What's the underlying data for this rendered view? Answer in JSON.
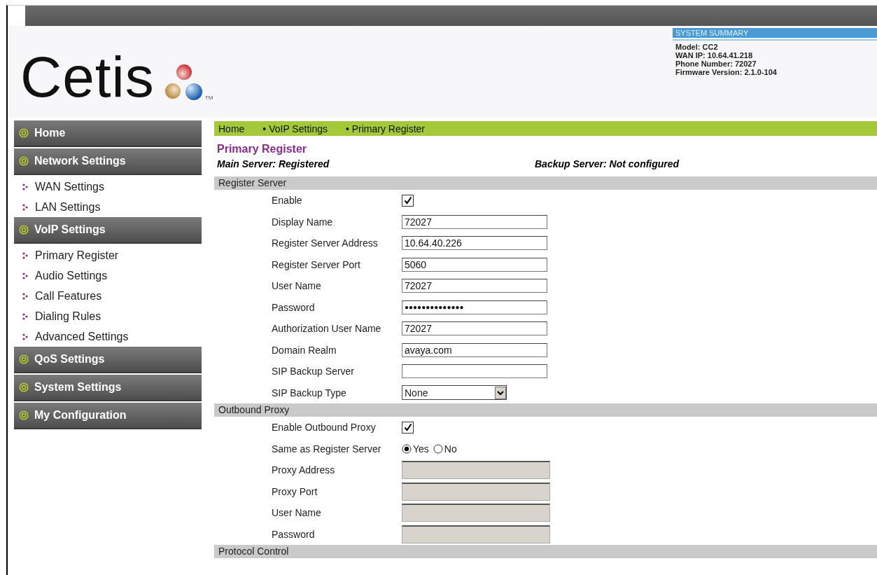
{
  "logo": {
    "wordmark": "Cetis",
    "trademark": "TM"
  },
  "system_summary": {
    "title": "SYSTEM SUMMARY",
    "lines": [
      "Model: CC2",
      "WAN IP: 10.64.41.218",
      "Phone Number: 72027",
      "Firmware Version: 2.1.0-104"
    ]
  },
  "sidebar": {
    "groups": [
      {
        "label": "Home"
      },
      {
        "label": "Network Settings",
        "children": [
          {
            "label": "WAN Settings"
          },
          {
            "label": "LAN Settings"
          }
        ]
      },
      {
        "label": "VoIP Settings",
        "children": [
          {
            "label": "Primary Register"
          },
          {
            "label": "Audio Settings"
          },
          {
            "label": "Call Features"
          },
          {
            "label": "Dialing Rules"
          },
          {
            "label": "Advanced Settings"
          }
        ]
      },
      {
        "label": "QoS Settings"
      },
      {
        "label": "System Settings"
      },
      {
        "label": "My Configuration"
      }
    ]
  },
  "breadcrumb": [
    "Home",
    "• VoIP Settings",
    "• Primary Register"
  ],
  "page_title": "Primary Register",
  "status": {
    "main": "Main Server: Registered",
    "backup": "Backup Server: Not configured"
  },
  "sections": [
    {
      "title": "Register Server",
      "rows": [
        {
          "kind": "checkbox",
          "label": "Enable",
          "checked": true
        },
        {
          "kind": "text",
          "label": "Display Name",
          "value": "72027",
          "disabled": false
        },
        {
          "kind": "text",
          "label": "Register Server Address",
          "value": "10.64.40.226",
          "disabled": false
        },
        {
          "kind": "text",
          "label": "Register Server Port",
          "value": "5060",
          "disabled": false
        },
        {
          "kind": "text",
          "label": "User Name",
          "value": "72027",
          "disabled": false
        },
        {
          "kind": "password",
          "label": "Password",
          "value": "●●●●●●●●●●●●●●",
          "disabled": false
        },
        {
          "kind": "text",
          "label": "Authorization User Name",
          "value": "72027",
          "disabled": false
        },
        {
          "kind": "text",
          "label": "Domain Realm",
          "value": "avaya.com",
          "disabled": false
        },
        {
          "kind": "text",
          "label": "SIP Backup Server",
          "disabled": false
        },
        {
          "kind": "select",
          "label": "SIP Backup Type",
          "value": "None"
        }
      ]
    },
    {
      "title": "Outbound Proxy",
      "rows": [
        {
          "kind": "checkbox",
          "label": "Enable Outbound Proxy",
          "checked": true
        },
        {
          "kind": "radio",
          "label": "Same as Register Server",
          "options": [
            {
              "label": "Yes",
              "selected": true
            },
            {
              "label": "No",
              "selected": false
            }
          ]
        },
        {
          "kind": "text",
          "label": "Proxy Address",
          "disabled": true
        },
        {
          "kind": "text",
          "label": "Proxy Port",
          "disabled": true
        },
        {
          "kind": "text",
          "label": "User Name",
          "disabled": true
        },
        {
          "kind": "text",
          "label": "Password",
          "disabled": true
        }
      ]
    },
    {
      "title": "Protocol Control"
    }
  ]
}
